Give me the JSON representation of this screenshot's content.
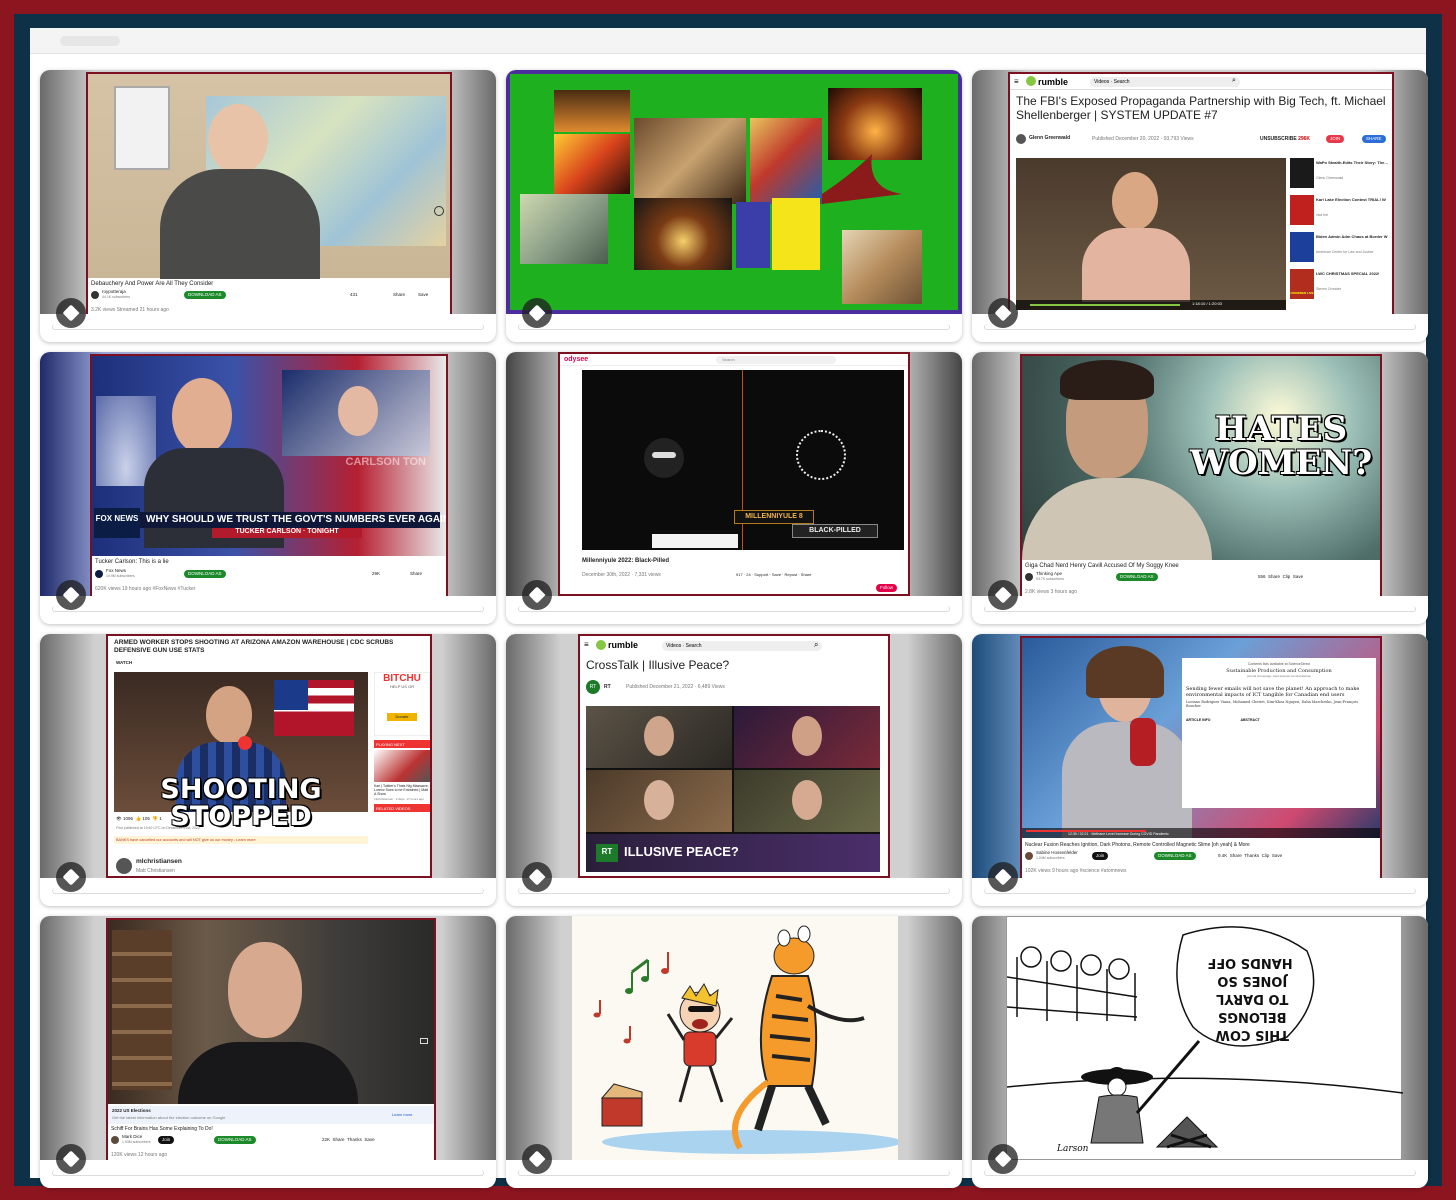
{
  "cards": [
    {
      "title": "Debauchery And Power Are All They Consider",
      "channel": "roypotteraja",
      "subs": "44.1K subscribers",
      "download": "DOWNLOAD AS",
      "likes": "431",
      "share": "Share",
      "save": "Save",
      "meta": "3.2K views  Streamed 21 hours ago"
    },
    {
      "collage": "religious-art-collage"
    },
    {
      "site": "rumble",
      "nav": "Videos",
      "search": "Search",
      "title": "The FBI's Exposed Propaganda Partnership with Big Tech, ft. Michael Shellenberger | SYSTEM UPDATE #7",
      "channel": "Glenn Greenwald",
      "published": "Published December 20, 2022  ·  93,793 Views",
      "unsub": "UNSUBSCRIBE",
      "unsub_count": "296K",
      "join": "JOIN",
      "share": "SHARE",
      "time": "1:18:10 / 1:20:03",
      "sidebar": [
        {
          "t": "WaPo Stealth-Edits Their Story: The…",
          "s": "Glenn Greenwald"
        },
        {
          "t": "Kari Lake Election Contest TRIAL! W",
          "s": "viva frei"
        },
        {
          "t": "Biden Admin Adm Chaos at Border W",
          "s": "American Center for Law and Justice"
        },
        {
          "t": "LWC CHRISTMAS SPECIAL 2022!",
          "s": "Steven Crowder"
        }
      ],
      "thumb_label": "CROWDER LIVE"
    },
    {
      "chyron": "WHY SHOULD WE TRUST THE GOVT'S NUMBERS EVER AGAIN?",
      "show": "TUCKER CARLSON · TONIGHT",
      "bg_name": "CARLSON TON",
      "logo": "FOX NEWS",
      "title": "Tucker Carlson: This is a lie",
      "channel": "Fox News",
      "subs": "10.9M subscribers",
      "download": "DOWNLOAD AS",
      "likes": "29K",
      "share": "Share",
      "meta": "620K views  19 hours ago  #FoxNews #Tucker"
    },
    {
      "site": "odysee",
      "search": "Search",
      "title": "Millenniyule 2022: Black-Pilled",
      "banner1": "MILLENNIYULE 8",
      "banner2": "BLACK-PILLED",
      "meta": "December 30th, 2022  ·  7,331 views",
      "likes": "917",
      "dislikes": "24",
      "support": "Support",
      "save": "Save",
      "repost": "Repost",
      "share": "Share",
      "follow": "Follow"
    },
    {
      "overlay_line1": "HATES",
      "overlay_line2": "WOMEN?",
      "title": "Giga Chad Nerd Henry Cavill Accused Of My Soggy Knee",
      "channel": "Thinking Ape",
      "subs": "93.7K subscribers",
      "download": "DOWNLOAD AS",
      "likes": "556",
      "share": "Share",
      "clip": "Clip",
      "save": "Save",
      "meta": "2.8K views  3 hours ago"
    },
    {
      "headline": "ARMED WORKER STOPS SHOOTING AT ARIZONA AMAZON WAREHOUSE | CDC SCRUBS DEFENSIVE GUN USE STATS",
      "watch": "WATCH",
      "overlay": "SHOOTING STOPPED",
      "views": "1096",
      "likes": "105",
      "dislikes": "1",
      "published": "First published at 19:40 UTC on December 21st, 2022.",
      "banner": "BANKS have cancelled our accounts and will NOT give us our money - Learn more",
      "channel": "mlchristiansen",
      "subs": "Matt Christiansen",
      "ad": "BITCHU",
      "ad_sub": "HELP US GR",
      "donate": "Donate",
      "playing_next": "PLAYING NEXT",
      "side_title": "Kari | Twitter's Thats Nig Massacre, Lorenz Sues to be Entrained | Matt A Show",
      "side_meta": "mlchristiansen · 2 days, 17 hours ago",
      "related": "RELATED VIDEOS"
    },
    {
      "site": "rumble",
      "nav": "Videos",
      "search": "Search",
      "title": "CrossTalk | Illusive Peace?",
      "channel": "RT",
      "published": "Published December 21, 2022  ·  6,489 Views",
      "overlay": "ILLUSIVE PEACE?",
      "logo": "RT"
    },
    {
      "paper_header": "Contents lists available at ScienceDirect",
      "journal": "Sustainable Production and Consumption",
      "journal_url": "journal homepage: www.elsevier.com/locate/spc",
      "paper_title": "Sending fewer emails will not save the planet! An approach to make environmental impacts of ICT tangible for Canadian end users",
      "authors": "Luciano Rodrigues Viana, Mohamed Cheriet, Kim-Khoa Nguyen, Dalia Marchesko, Jean-François Boucher",
      "section1": "ARTICLE INFO",
      "section2": "ABSTRACT",
      "cite_line1": "Viana et al",
      "cite_line2": "Sustainable Production and Consumption 34 (2022) 453-466",
      "player_time": "12:39 / 32:21  ·  Methane Level Increase During COVID Pandemic",
      "title": "Nuclear Fusion Reaches Ignition, Dark Photons, Remote Controlled Magnetic Slime [oh yeah] & More",
      "channel": "Sabine Hossenfelder",
      "subs": "1.04M subscribers",
      "join": "Join",
      "download": "DOWNLOAD AS",
      "likes": "9.4K",
      "share": "Share",
      "thanks": "Thanks",
      "clip": "Clip",
      "save": "Save",
      "meta": "102K views  9 hours ago  #science #atomnews"
    },
    {
      "banner_title": "2022 US Elections",
      "banner_text": "Get the latest information about the election outcome on Google",
      "learn_more": "Learn more",
      "title": "Schiff For Brains Has Some Explaining To Do!",
      "channel": "Mark Dice",
      "subs": "1.93M subscribers",
      "join": "Join",
      "download": "DOWNLOAD AS",
      "likes": "22K",
      "share": "Share",
      "thanks": "Thanks",
      "save": "Save",
      "meta": "120K views  12 hours ago"
    },
    {
      "cartoon": "calvin-and-hobbes-dance"
    },
    {
      "sign_line1": "THIS COW",
      "sign_line2": "BELONGS",
      "sign_line3": "TO DARYL",
      "sign_line4": "JONES SO",
      "sign_line5": "HANDS OFF",
      "signature": "Larson"
    }
  ],
  "colors": {
    "frame_outer": "#8c1520",
    "frame_inner": "#0e3147",
    "shot_border": "#7a1020",
    "yt_green": "#1c8a2a",
    "rumble_green": "#85c742",
    "collage_green": "#1fb01f",
    "collage_border": "#4b2d9e"
  }
}
